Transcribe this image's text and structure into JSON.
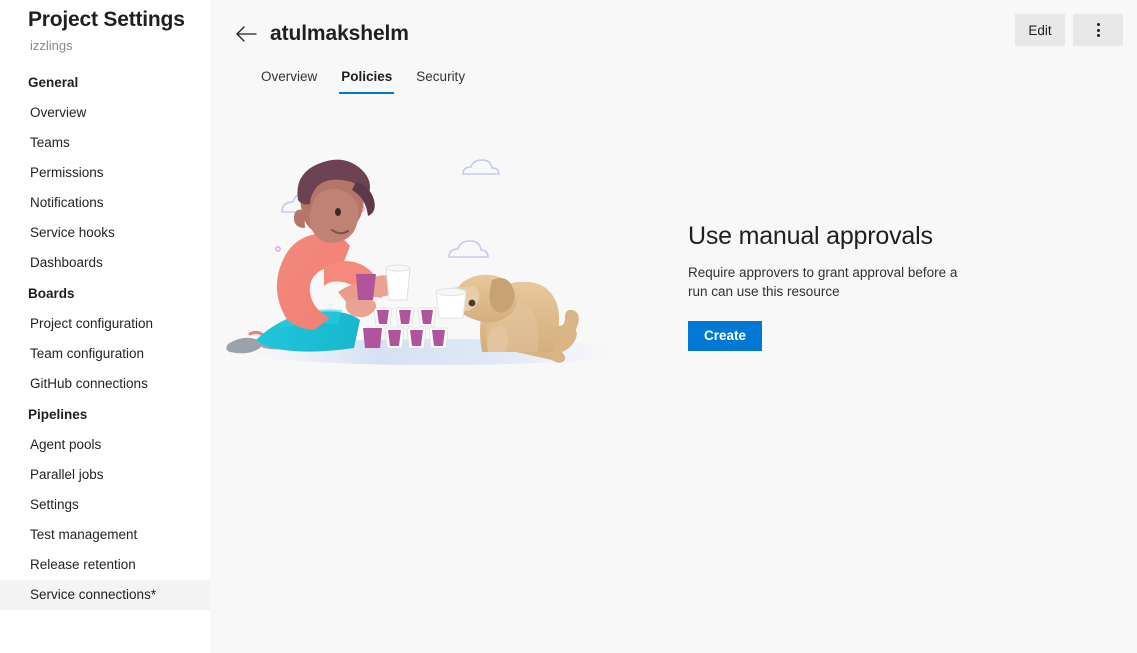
{
  "sidebar": {
    "title": "Project Settings",
    "subtitle": "izzlings",
    "groups": [
      {
        "header": "General",
        "items": [
          {
            "label": "Overview",
            "selected": false
          },
          {
            "label": "Teams",
            "selected": false
          },
          {
            "label": "Permissions",
            "selected": false
          },
          {
            "label": "Notifications",
            "selected": false
          },
          {
            "label": "Service hooks",
            "selected": false
          },
          {
            "label": "Dashboards",
            "selected": false
          }
        ]
      },
      {
        "header": "Boards",
        "items": [
          {
            "label": "Project configuration",
            "selected": false
          },
          {
            "label": "Team configuration",
            "selected": false
          },
          {
            "label": "GitHub connections",
            "selected": false
          }
        ]
      },
      {
        "header": "Pipelines",
        "items": [
          {
            "label": "Agent pools",
            "selected": false
          },
          {
            "label": "Parallel jobs",
            "selected": false
          },
          {
            "label": "Settings",
            "selected": false
          },
          {
            "label": "Test management",
            "selected": false
          },
          {
            "label": "Release retention",
            "selected": false
          },
          {
            "label": "Service connections*",
            "selected": true
          }
        ]
      }
    ]
  },
  "header": {
    "back_icon": "arrow-left-icon",
    "title": "atulmakshelm",
    "edit_label": "Edit",
    "more_icon": "more-vertical-icon",
    "tabs": [
      {
        "label": "Overview",
        "active": false
      },
      {
        "label": "Policies",
        "active": true
      },
      {
        "label": "Security",
        "active": false
      }
    ]
  },
  "empty_state": {
    "illustration_name": "person-stacking-cups-with-dog-illustration",
    "title": "Use manual approvals",
    "description": "Require approvers to grant approval before a run can use this resource",
    "create_label": "Create"
  },
  "scrollbar": {
    "up_arrow_icon": "chevron-up-icon"
  },
  "colors": {
    "accent": "#0078d4",
    "sidebar_selected": "#f4f4f4",
    "content_bg": "#f8f8f8",
    "subtle_button": "#e8e8e8"
  }
}
